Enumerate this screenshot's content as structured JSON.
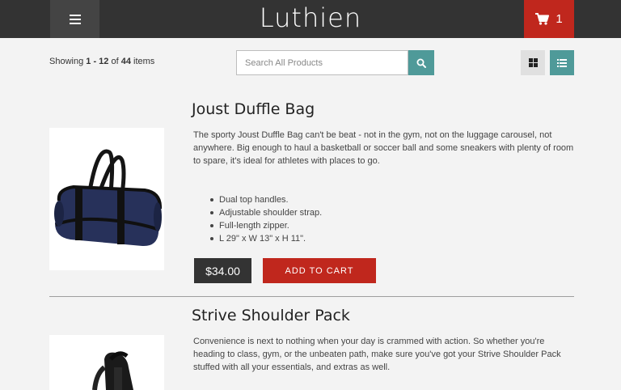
{
  "header": {
    "logo": "Luthien",
    "cart_count": "1"
  },
  "toolbar": {
    "count_prefix": "Showing ",
    "count_range": "1 - 12",
    "count_mid": " of ",
    "count_total": "44",
    "count_suffix": " items",
    "search_placeholder": "Search All Products"
  },
  "products": [
    {
      "title": "Joust Duffle Bag",
      "description": "The sporty Joust Duffle Bag can't be beat - not in the gym, not on the luggage carousel, not anywhere. Big enough to haul a basketball or soccer ball and some sneakers with plenty of room to spare, it's ideal for athletes with places to go.",
      "features": [
        "Dual top handles.",
        "Adjustable shoulder strap.",
        "Full-length zipper.",
        "L 29\" x W 13\" x H 11\"."
      ],
      "price": "$34.00",
      "add_to_cart": "ADD TO CART"
    },
    {
      "title": "Strive Shoulder Pack",
      "description": "Convenience is next to nothing when your day is crammed with action. So whether you're heading to class, gym, or the unbeaten path, make sure you've got your Strive Shoulder Pack stuffed with all your essentials, and extras as well."
    }
  ],
  "colors": {
    "brand_red": "#c0271d",
    "teal": "#4f9a99",
    "dark": "#333333"
  }
}
